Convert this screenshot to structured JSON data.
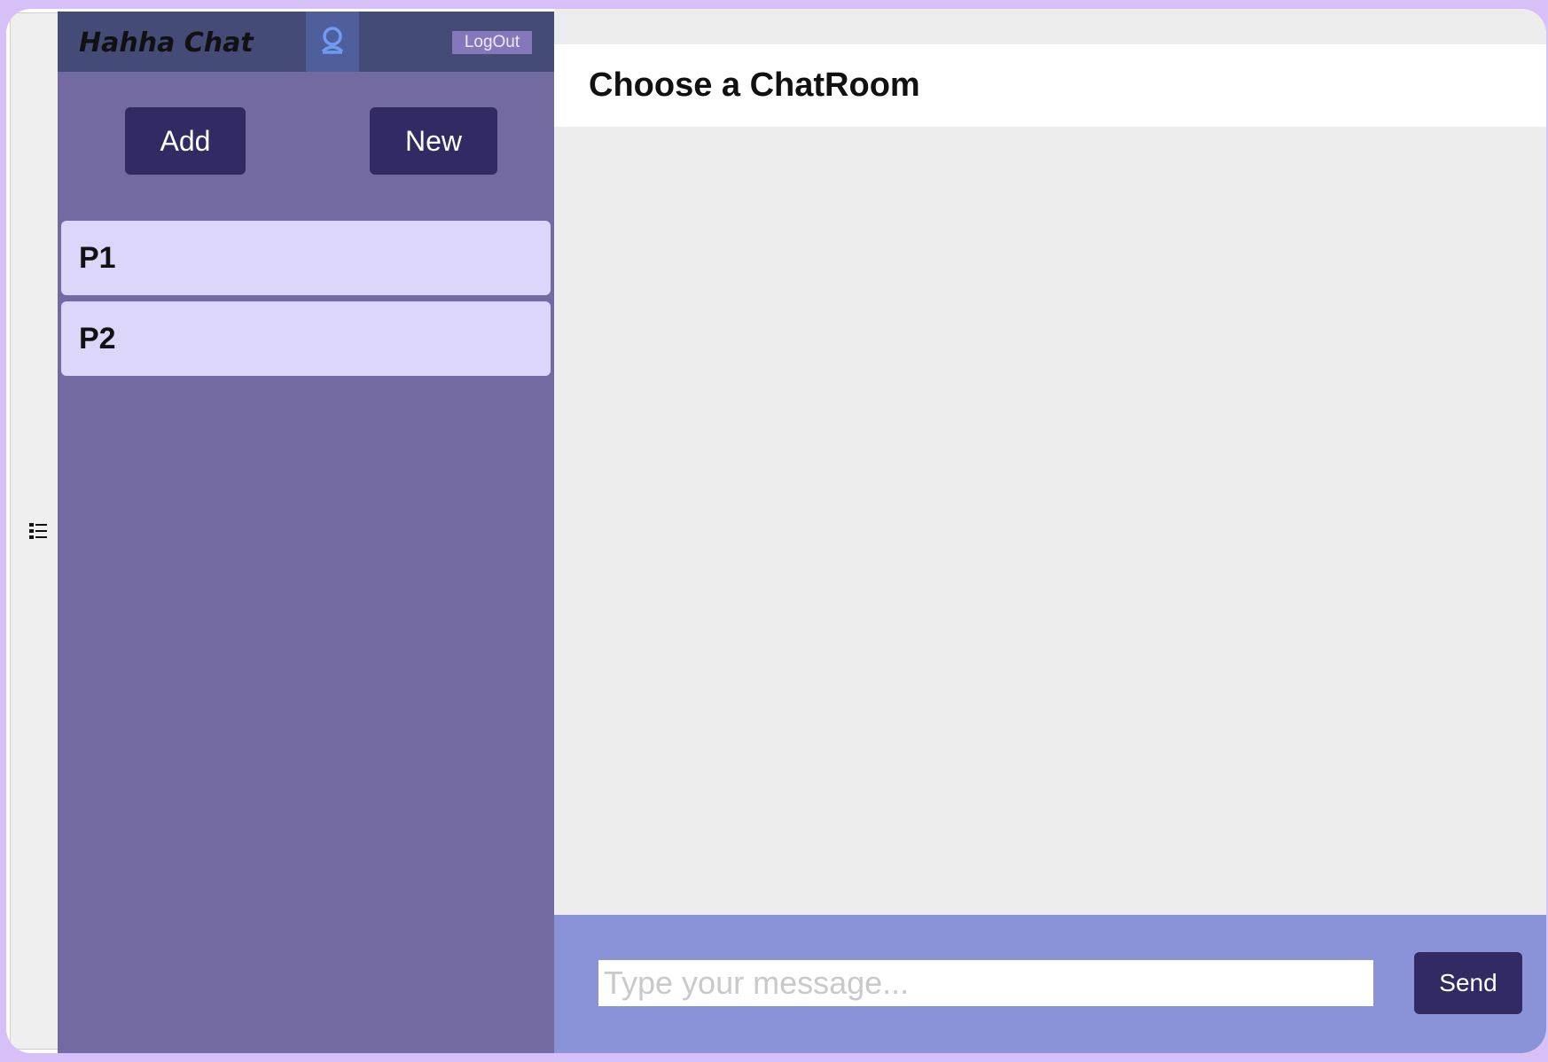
{
  "sidebar": {
    "app_title": "Hahha Chat",
    "profile_icon": "user-icon",
    "logout_label": "LogOut",
    "add_label": "Add",
    "new_label": "New",
    "rooms": [
      {
        "label": "P1"
      },
      {
        "label": "P2"
      }
    ]
  },
  "rail": {
    "toggle_icon": "list-icon"
  },
  "main": {
    "title": "Choose a ChatRoom",
    "message_placeholder": "Type your message...",
    "send_label": "Send"
  },
  "colors": {
    "page_border": "#d6c0f7",
    "sidebar_bg": "#736aa2",
    "top_bar_bg": "#434b76",
    "button_bg": "#312a63",
    "room_item_bg": "#ddd6fb",
    "compose_bg": "#8b93d8",
    "main_bg": "#ededed"
  }
}
